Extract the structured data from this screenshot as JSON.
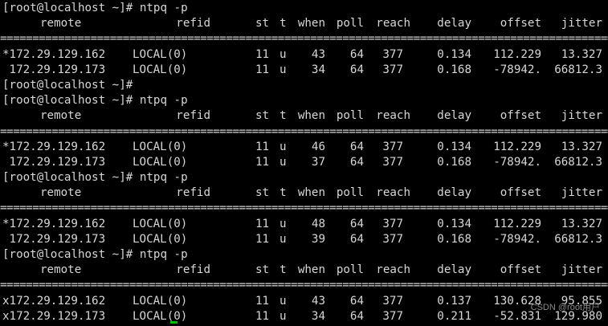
{
  "terminal": {
    "prompt": "[root@localhost ~]# ",
    "command": "ntpq -p",
    "separator": "==============================================================================================================================",
    "headers": [
      "remote",
      "refid",
      "st",
      "t",
      "when",
      "poll",
      "reach",
      "delay",
      "offset",
      "jitter"
    ],
    "blocks": [
      {
        "rows": [
          [
            "*172.29.129.162",
            "LOCAL(0)",
            "11",
            "u",
            "43",
            "64",
            "377",
            "0.134",
            "112.229",
            "13.327"
          ],
          [
            " 172.29.129.173",
            "LOCAL(0)",
            "11",
            "u",
            "34",
            "64",
            "377",
            "0.168",
            "-78942.",
            "66812.3"
          ]
        ],
        "trailing_prompt": "[root@localhost ~]#"
      },
      {
        "rows": [
          [
            "*172.29.129.162",
            "LOCAL(0)",
            "11",
            "u",
            "46",
            "64",
            "377",
            "0.134",
            "112.229",
            "13.327"
          ],
          [
            " 172.29.129.173",
            "LOCAL(0)",
            "11",
            "u",
            "37",
            "64",
            "377",
            "0.168",
            "-78942.",
            "66812.3"
          ]
        ]
      },
      {
        "rows": [
          [
            "*172.29.129.162",
            "LOCAL(0)",
            "11",
            "u",
            "48",
            "64",
            "377",
            "0.134",
            "112.229",
            "13.327"
          ],
          [
            " 172.29.129.173",
            "LOCAL(0)",
            "11",
            "u",
            "39",
            "64",
            "377",
            "0.168",
            "-78942.",
            "66812.3"
          ]
        ]
      },
      {
        "rows": [
          [
            "x172.29.129.162",
            "LOCAL(0)",
            "11",
            "u",
            "43",
            "64",
            "377",
            "0.137",
            "130.628",
            "95.855"
          ],
          [
            "x172.29.129.173",
            "LOCAL(0)",
            "11",
            "u",
            "34",
            "64",
            "377",
            "0.211",
            "-52.831",
            "129.980"
          ]
        ]
      }
    ],
    "watermark": "CSDN @root用户"
  },
  "colors": {
    "background": "#000000",
    "foreground": "#d6d6d6",
    "cursor": "#00c000"
  }
}
